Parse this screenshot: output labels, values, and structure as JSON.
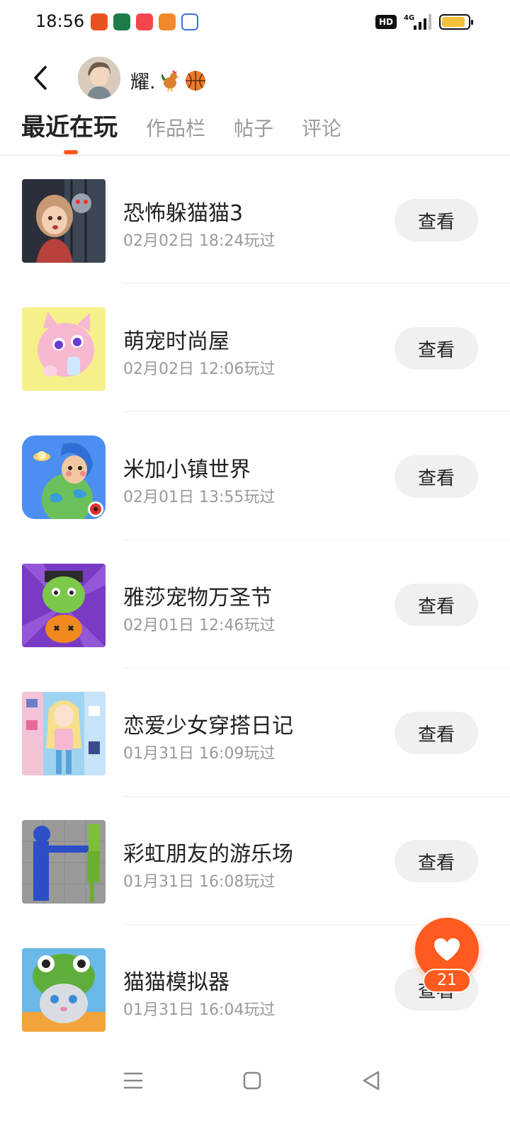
{
  "status_bar": {
    "time": "18:56",
    "hd_label": "HD",
    "network_label": "4G",
    "battery_level": 0.9,
    "battery_color": "#f5c13b"
  },
  "header": {
    "back_icon": "chevron-left-icon",
    "user_name": "耀.",
    "name_emoji": [
      "rooster",
      "basketball"
    ]
  },
  "tabs": [
    {
      "label": "最近在玩",
      "active": true
    },
    {
      "label": "作品栏",
      "active": false
    },
    {
      "label": "帖子",
      "active": false
    },
    {
      "label": "评论",
      "active": false
    }
  ],
  "accent_color": "#ff5a1f",
  "games": [
    {
      "title": "恐怖躲猫猫3",
      "played": "02月02日 18:24玩过",
      "button": "查看"
    },
    {
      "title": "萌宠时尚屋",
      "played": "02月02日 12:06玩过",
      "button": "查看"
    },
    {
      "title": "米加小镇世界",
      "played": "02月01日 13:55玩过",
      "button": "查看"
    },
    {
      "title": "雅莎宠物万圣节",
      "played": "02月01日 12:46玩过",
      "button": "查看"
    },
    {
      "title": "恋爱少女穿搭日记",
      "played": "01月31日 16:09玩过",
      "button": "查看"
    },
    {
      "title": "彩虹朋友的游乐场",
      "played": "01月31日 16:08玩过",
      "button": "查看"
    },
    {
      "title": "猫猫模拟器",
      "played": "01月31日 16:04玩过",
      "button": "查看"
    }
  ],
  "fab": {
    "icon": "heart-icon",
    "count": "21"
  },
  "system_nav": [
    "menu-icon",
    "home-icon",
    "back-triangle-icon"
  ]
}
